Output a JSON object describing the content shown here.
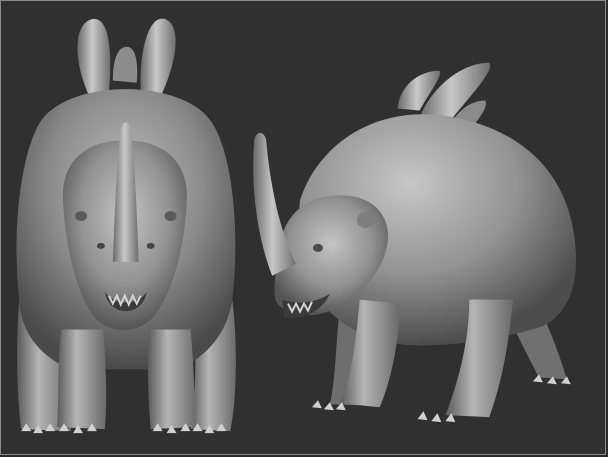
{
  "scene": {
    "background": "#303030",
    "border": "#8a8a8a",
    "clay_base": "#8d8d8d",
    "clay_light": "#c9c9c9",
    "clay_shadow": "#3e3e3e"
  },
  "renders": [
    {
      "view": "front",
      "subject": "horned-creature-sculpt"
    },
    {
      "view": "three-quarter",
      "subject": "horned-creature-sculpt"
    }
  ]
}
